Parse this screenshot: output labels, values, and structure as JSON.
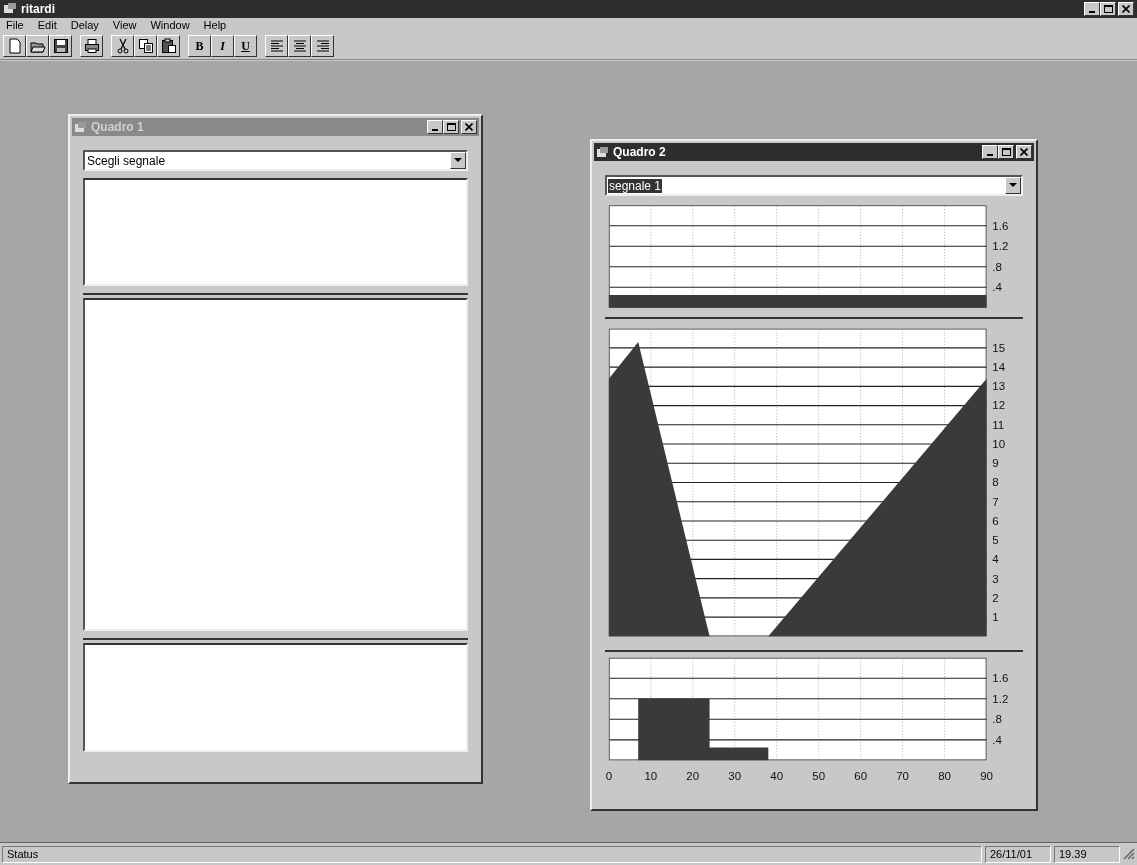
{
  "app": {
    "title": "ritardi"
  },
  "menu": [
    "File",
    "Edit",
    "Delay",
    "View",
    "Window",
    "Help"
  ],
  "format_buttons": [
    "B",
    "I",
    "U"
  ],
  "windows": [
    {
      "title": "Quadro 1",
      "active": false,
      "combo": {
        "value": "Scegli segnale",
        "highlighted": false
      },
      "panes": [
        {
          "kind": "blank"
        },
        {
          "kind": "blank"
        },
        {
          "kind": "blank"
        }
      ]
    },
    {
      "title": "Quadro 2",
      "active": true,
      "combo": {
        "value": "segnale 1",
        "highlighted": true
      },
      "panes": [
        {
          "kind": "chart",
          "chart_data": {
            "type": "area",
            "grid": true,
            "x": [
              0,
              90
            ],
            "series": [
              {
                "color": "#3a3a3a",
                "values": [
                  0.25,
                  0.25
                ]
              }
            ],
            "xlim": [
              0,
              90
            ],
            "ylim": [
              0,
              2
            ],
            "yticks": [
              {
                "value": 0.4,
                "label": ".4"
              },
              {
                "value": 0.8,
                "label": ".8"
              },
              {
                "value": 1.2,
                "label": "1.2"
              },
              {
                "value": 1.6,
                "label": "1.6"
              }
            ]
          }
        },
        {
          "kind": "chart",
          "chart_data": {
            "type": "area",
            "grid": true,
            "x": [
              0,
              7,
              24,
              38,
              90
            ],
            "series": [
              {
                "color": "#3a3a3a",
                "values": [
                  13.4,
                  15.3,
                  0,
                  0,
                  13.4
                ]
              }
            ],
            "xlim": [
              0,
              90
            ],
            "ylim": [
              0,
              16
            ],
            "yticks": [
              1,
              2,
              3,
              4,
              5,
              6,
              7,
              8,
              9,
              10,
              11,
              12,
              13,
              14,
              15
            ]
          }
        },
        {
          "kind": "chart",
          "chart_data": {
            "type": "area",
            "grid": true,
            "x": [
              7,
              7,
              24,
              24,
              38,
              38
            ],
            "series": [
              {
                "color": "#3a3a3a",
                "values": [
                  0,
                  1.2,
                  1.2,
                  0.25,
                  0.25,
                  0
                ]
              }
            ],
            "xlim": [
              0,
              90
            ],
            "ylim": [
              0,
              2
            ],
            "xticks": [
              0,
              10,
              20,
              30,
              40,
              50,
              60,
              70,
              80,
              90
            ],
            "yticks": [
              {
                "value": 0.4,
                "label": ".4"
              },
              {
                "value": 0.8,
                "label": ".8"
              },
              {
                "value": 1.2,
                "label": "1.2"
              },
              {
                "value": 1.6,
                "label": "1.6"
              }
            ]
          }
        }
      ]
    }
  ],
  "status_bar": {
    "text": "Status",
    "date": "26/11/01",
    "time": "19.39"
  }
}
